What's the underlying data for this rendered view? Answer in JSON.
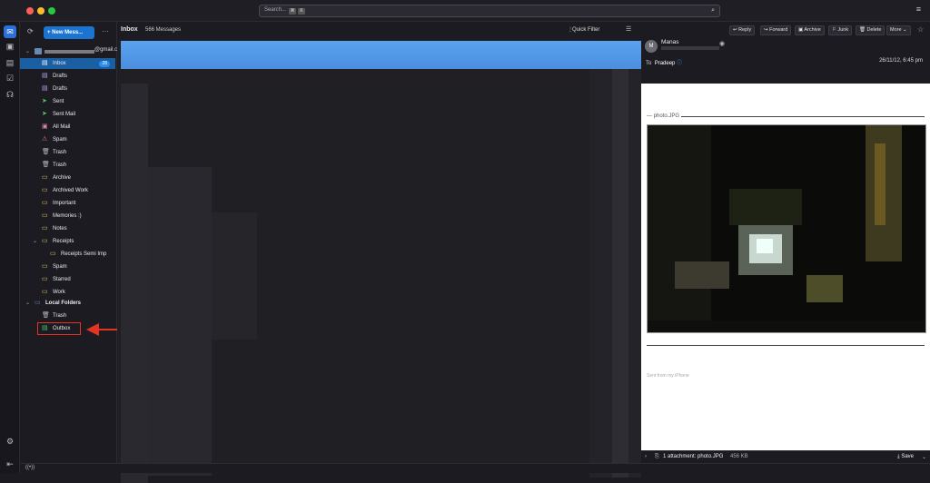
{
  "search": {
    "placeholder": "Search...",
    "key1": "⌘",
    "key2": "K"
  },
  "toolbar": {
    "new_message": "New Mess...",
    "more_dots": "···"
  },
  "account": {
    "email": "@gmail.com"
  },
  "folders": [
    {
      "label": "Inbox",
      "icon": "inbox-icon",
      "badge": "28"
    },
    {
      "label": "Drafts",
      "icon": "drafts-icon"
    },
    {
      "label": "Drafts",
      "icon": "drafts-icon"
    },
    {
      "label": "Sent",
      "icon": "sent-icon"
    },
    {
      "label": "Sent Mail",
      "icon": "sent-icon"
    },
    {
      "label": "All Mail",
      "icon": "archive-icon"
    },
    {
      "label": "Spam",
      "icon": "spam-icon"
    },
    {
      "label": "Trash",
      "icon": "trash-icon"
    },
    {
      "label": "Trash",
      "icon": "trash-icon"
    },
    {
      "label": "Archive",
      "icon": "folder-icon"
    },
    {
      "label": "Archived Work",
      "icon": "folder-icon"
    },
    {
      "label": "Important",
      "icon": "folder-icon"
    },
    {
      "label": "Memories :)",
      "icon": "folder-icon"
    },
    {
      "label": "Notes",
      "icon": "folder-icon"
    },
    {
      "label": "Receipts",
      "icon": "folder-icon"
    },
    {
      "label": "Receipts Semi Imp",
      "icon": "folder-icon"
    },
    {
      "label": "Spam",
      "icon": "folder-icon"
    },
    {
      "label": "Starred",
      "icon": "folder-icon"
    },
    {
      "label": "Work",
      "icon": "folder-icon"
    }
  ],
  "local": {
    "label": "Local Folders",
    "trash": "Trash",
    "outbox": "Outbox"
  },
  "list": {
    "title": "Inbox",
    "count": "566 Messages",
    "quick_filter": "Quick Filter"
  },
  "message": {
    "buttons": [
      "Reply",
      "Forward",
      "Archive",
      "Junk",
      "Delete",
      "More"
    ],
    "avatar": "M",
    "sender": "Manas",
    "to_label": "To",
    "to_name": "Pradeep",
    "date": "26/11/12, 6:45 pm",
    "attachment_name": "photo.JPG",
    "attachment_summary": "1 attachment: photo.JPG",
    "attachment_size": "456 KB",
    "save": "Save",
    "signature": "Sent from my iPhone"
  },
  "colors": {
    "accent": "#1b75d0",
    "selection": "#1b5fa3",
    "highlight": "#e53321"
  }
}
